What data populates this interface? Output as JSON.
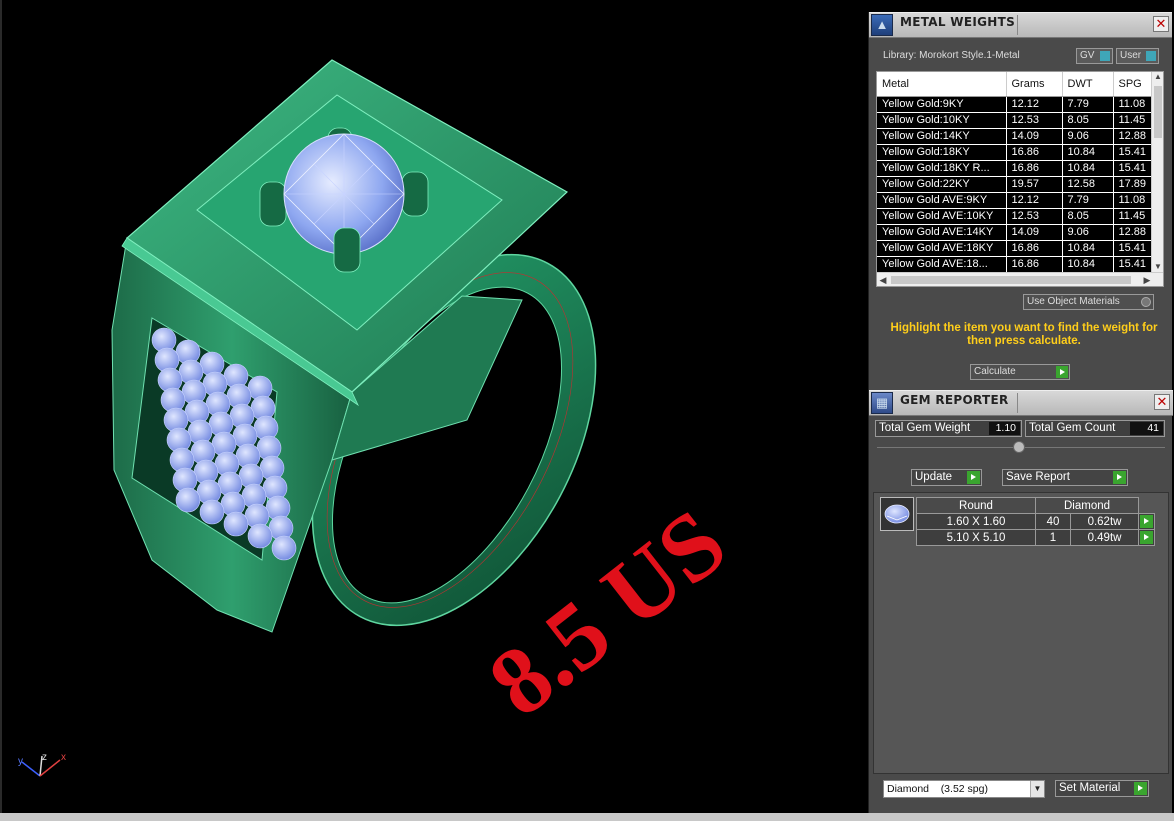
{
  "viewport": {
    "ring_size_label": "8.5 US",
    "axes": {
      "y": "y",
      "z": "z",
      "x": "x"
    }
  },
  "metal_weights": {
    "title": "METAL WEIGHTS",
    "library": "Library: Morokort Style.1-Metal",
    "toggle_gv": "GV",
    "toggle_user": "User",
    "columns": [
      "Metal",
      "Grams",
      "DWT",
      "SPG"
    ],
    "rows": [
      [
        "Yellow Gold:9KY",
        "12.12",
        "7.79",
        "11.08"
      ],
      [
        "Yellow Gold:10KY",
        "12.53",
        "8.05",
        "11.45"
      ],
      [
        "Yellow Gold:14KY",
        "14.09",
        "9.06",
        "12.88"
      ],
      [
        "Yellow Gold:18KY",
        "16.86",
        "10.84",
        "15.41"
      ],
      [
        "Yellow Gold:18KY R...",
        "16.86",
        "10.84",
        "15.41"
      ],
      [
        "Yellow Gold:22KY",
        "19.57",
        "12.58",
        "17.89"
      ],
      [
        "Yellow Gold AVE:9KY",
        "12.12",
        "7.79",
        "11.08"
      ],
      [
        "Yellow Gold AVE:10KY",
        "12.53",
        "8.05",
        "11.45"
      ],
      [
        "Yellow Gold AVE:14KY",
        "14.09",
        "9.06",
        "12.88"
      ],
      [
        "Yellow Gold AVE:18KY",
        "16.86",
        "10.84",
        "15.41"
      ],
      [
        "Yellow Gold AVE:18...",
        "16.86",
        "10.84",
        "15.41"
      ]
    ],
    "use_object_materials": "Use Object Materials",
    "hint": "Highlight the item you want to find the weight for then press calculate.",
    "calculate": "Calculate"
  },
  "gem_reporter": {
    "title": "GEM REPORTER",
    "total_weight_label": "Total Gem Weight",
    "total_weight_value": "1.10",
    "total_count_label": "Total Gem Count",
    "total_count_value": "41",
    "update": "Update",
    "save_report": "Save Report",
    "table_headers": [
      "Round",
      "Diamond"
    ],
    "rows": [
      {
        "size": "1.60 X 1.60",
        "count": "40",
        "weight": "0.62tw"
      },
      {
        "size": "5.10 X 5.10",
        "count": "1",
        "weight": "0.49tw"
      }
    ],
    "material_select": "Diamond    (3.52 spg)",
    "set_material": "Set Material"
  },
  "colors": {
    "ring_green": "#2f9f6e",
    "gem_blue": "#8ea7f0",
    "label_red": "#e0101a",
    "hint_yellow": "#ffce1a",
    "go_green": "#3aa52f"
  }
}
